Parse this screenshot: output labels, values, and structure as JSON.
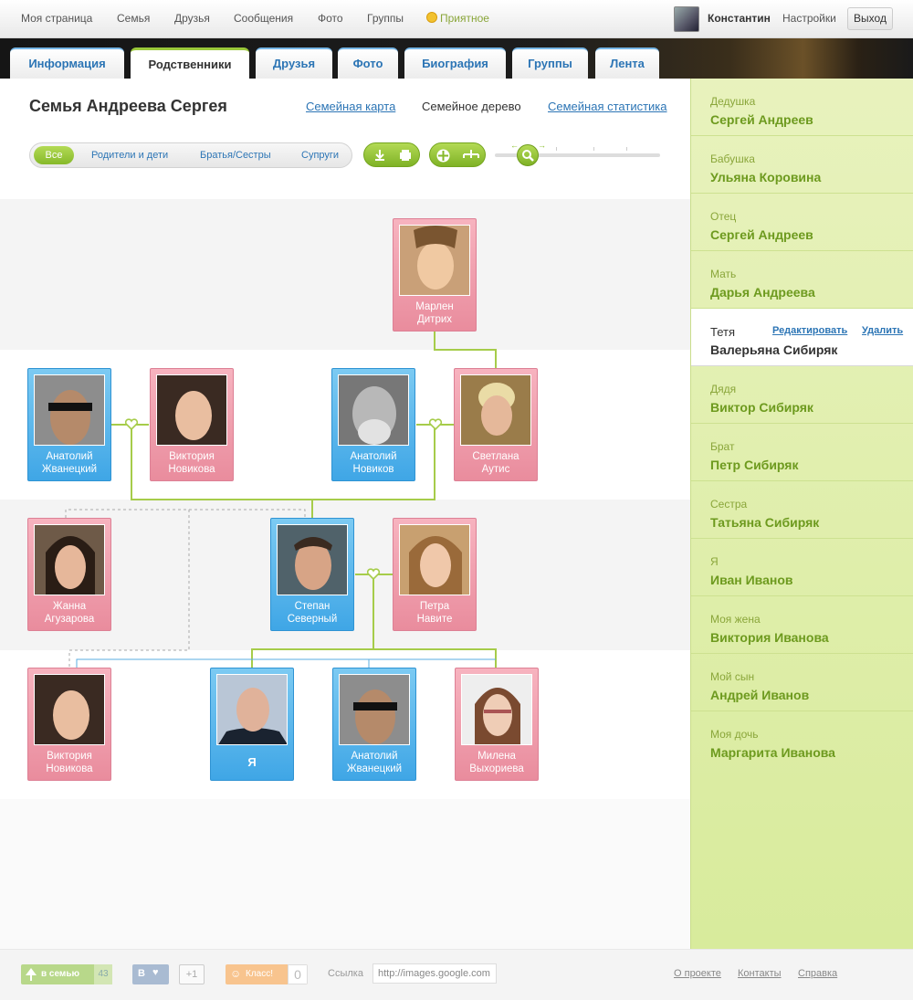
{
  "topnav": {
    "items": [
      "Моя страница",
      "Семья",
      "Друзья",
      "Сообщения",
      "Фото",
      "Группы"
    ],
    "mood": "Приятное",
    "user_name": "Константин",
    "settings": "Настройки",
    "logout": "Выход"
  },
  "tabs": [
    "Информация",
    "Родственники",
    "Друзья",
    "Фото",
    "Биография",
    "Группы",
    "Лента"
  ],
  "active_tab": "Родственники",
  "header": {
    "title": "Семья Андреева Сергея",
    "family_map": "Семейная карта",
    "family_tree": "Семейное дерево",
    "family_stats": "Семейная статистика"
  },
  "filters": {
    "all": "Все",
    "parents_children": "Родители и дети",
    "siblings": "Братья/Сестры",
    "spouses": "Супруги"
  },
  "tree": {
    "people": [
      {
        "id": "marlen",
        "name1": "Марлен",
        "name2": "Дитрих",
        "gender": "f"
      },
      {
        "id": "anatoliy-zh-1",
        "name1": "Анатолий",
        "name2": "Жванецкий",
        "gender": "m"
      },
      {
        "id": "viktoriya-n-1",
        "name1": "Виктория",
        "name2": "Новикова",
        "gender": "f"
      },
      {
        "id": "anatoliy-n",
        "name1": "Анатолий",
        "name2": "Новиков",
        "gender": "m"
      },
      {
        "id": "svetlana",
        "name1": "Светлана",
        "name2": "Аутис",
        "gender": "f"
      },
      {
        "id": "zhanna",
        "name1": "Жанна",
        "name2": "Агузарова",
        "gender": "f"
      },
      {
        "id": "stepan",
        "name1": "Степан",
        "name2": "Северный",
        "gender": "m"
      },
      {
        "id": "petra",
        "name1": "Петра",
        "name2": "Навите",
        "gender": "f"
      },
      {
        "id": "viktoriya-n-2",
        "name1": "Виктория",
        "name2": "Новикова",
        "gender": "f"
      },
      {
        "id": "me",
        "name1": "Я",
        "name2": "",
        "gender": "m"
      },
      {
        "id": "anatoliy-zh-2",
        "name1": "Анатолий",
        "name2": "Жванецкий",
        "gender": "m"
      },
      {
        "id": "milena",
        "name1": "Милена",
        "name2": "Выхориева",
        "gender": "f"
      }
    ]
  },
  "sidebar": {
    "edit": "Редактировать",
    "delete": "Удалить",
    "relatives": [
      {
        "role": "Дедушка",
        "name": "Сергей Андреев"
      },
      {
        "role": "Бабушка",
        "name": "Ульяна Коровина"
      },
      {
        "role": "Отец",
        "name": "Сергей Андреев"
      },
      {
        "role": "Мать",
        "name": "Дарья Андреева"
      },
      {
        "role": "Тетя",
        "name": "Валерьяна Сибиряк"
      },
      {
        "role": "Дядя",
        "name": "Виктор Сибиряк"
      },
      {
        "role": "Брат",
        "name": "Петр Сибиряк"
      },
      {
        "role": "Сестра",
        "name": "Татьяна Сибиряк"
      },
      {
        "role": "Я",
        "name": "Иван Иванов"
      },
      {
        "role": "Моя жена",
        "name": "Виктория Иванова"
      },
      {
        "role": "Мой сын",
        "name": "Андрей Иванов"
      },
      {
        "role": "Моя дочь",
        "name": "Маргарита Иванова"
      }
    ]
  },
  "footer": {
    "share_family": "в семью",
    "share_family_count": "43",
    "vk": "В",
    "plusone": "+1",
    "ok": "Класс!",
    "ok_count": "0",
    "link_label": "Ссылка",
    "link_value": "http://images.google.com",
    "about": "О проекте",
    "contacts": "Контакты",
    "help": "Справка"
  },
  "colors": {
    "accent_green": "#8dbf2e",
    "link_blue": "#2c75b5",
    "female_card": "#f0a0b0",
    "male_card": "#4fb0ea",
    "sidebar_bg": "#dcee a8"
  }
}
